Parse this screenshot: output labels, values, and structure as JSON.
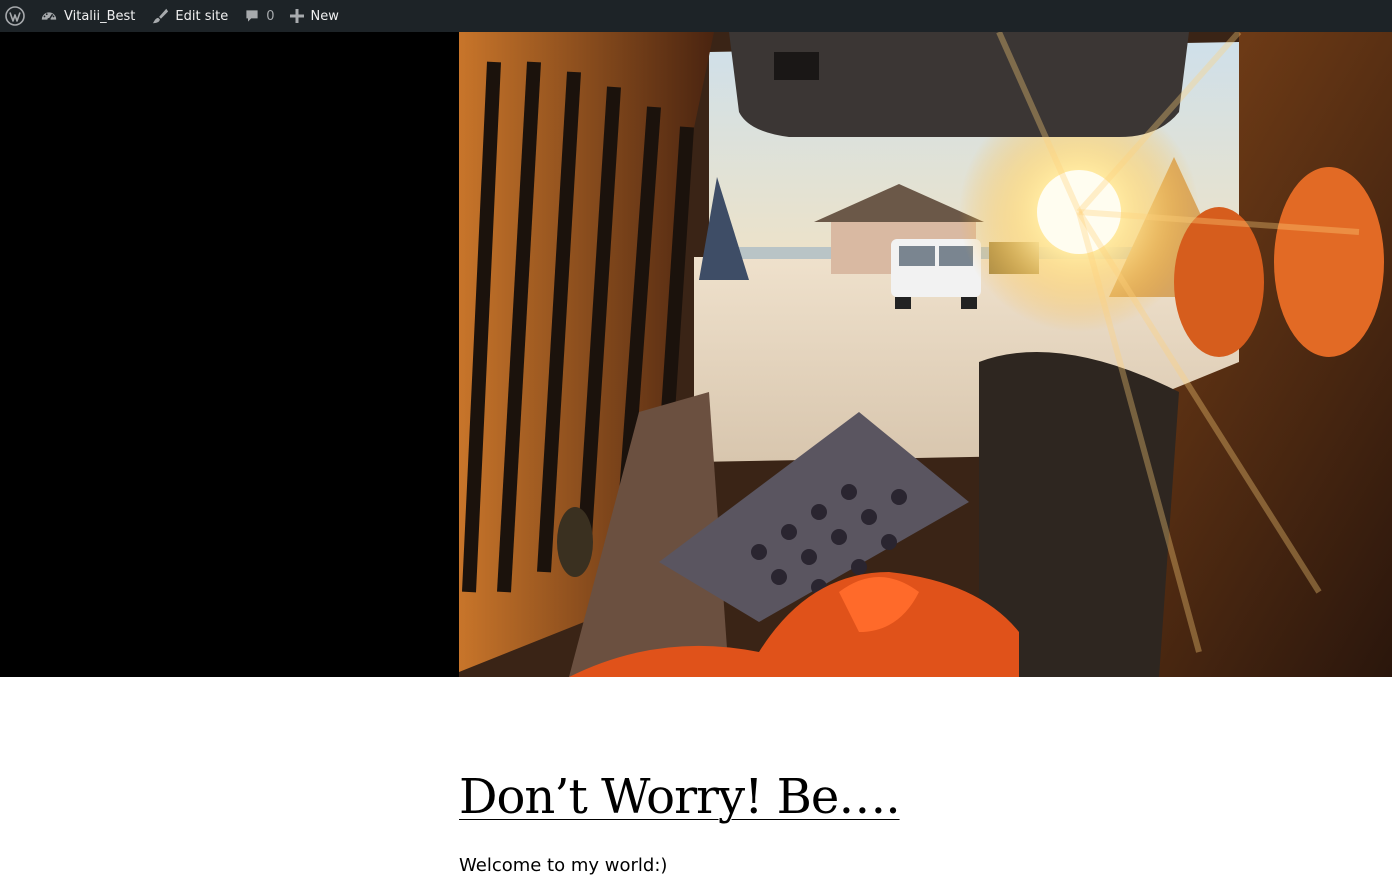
{
  "adminbar": {
    "wp_logo_icon": "wordpress-icon",
    "site_name": "Vitalii_Best",
    "site_icon": "dashboard-icon",
    "edit_site_label": "Edit site",
    "edit_icon": "brush-icon",
    "comments_count": "0",
    "comments_icon": "comment-icon",
    "new_label": "New",
    "new_icon": "plus-icon",
    "bg_color": "#1d2327"
  },
  "hero": {
    "image_alt": "Sunset view from inside a camper van on a beach",
    "bg_color": "#000000"
  },
  "post": {
    "title": "Don’t Worry! Be….",
    "excerpt": "Welcome to my world:)"
  }
}
